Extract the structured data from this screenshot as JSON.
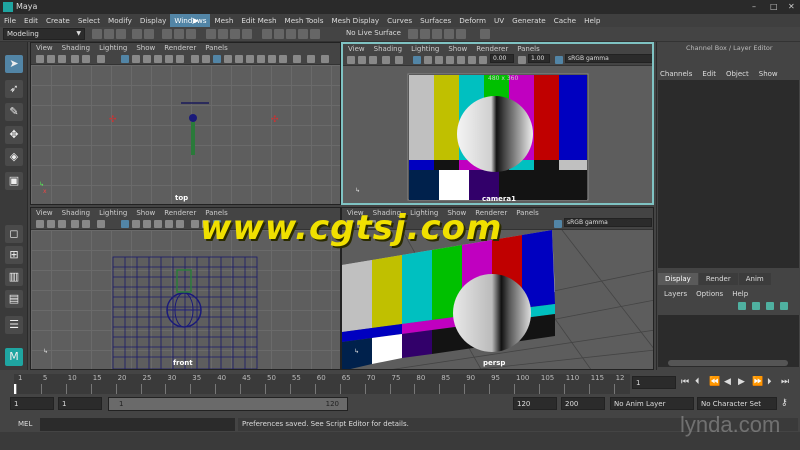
{
  "window": {
    "title": "Maya",
    "controls": [
      "–",
      "□",
      "✕"
    ]
  },
  "menubar": [
    "File",
    "Edit",
    "Create",
    "Select",
    "Modify",
    "Display",
    "Windows",
    "Mesh",
    "Edit Mesh",
    "Mesh Tools",
    "Mesh Display",
    "Curves",
    "Surfaces",
    "Deform",
    "UV",
    "Generate",
    "Cache",
    "Help"
  ],
  "menubar_selected": "Windows",
  "statusline": {
    "mode": "Modeling",
    "live_surface": "No Live Surface"
  },
  "viewport_menu": [
    "View",
    "Shading",
    "Lighting",
    "Show",
    "Renderer",
    "Panels"
  ],
  "viewports": {
    "top": {
      "label": "top"
    },
    "camera1": {
      "label": "camera1",
      "resolution": "480 x 360",
      "exposure": "0.00",
      "gamma": "1.00",
      "color_space": "sRGB gamma"
    },
    "front": {
      "label": "front"
    },
    "persp": {
      "label": "persp",
      "color_space": "sRGB gamma"
    }
  },
  "channel_box": {
    "title": "Channel Box / Layer Editor",
    "menu": [
      "Channels",
      "Edit",
      "Object",
      "Show"
    ]
  },
  "layer_editor": {
    "tabs": [
      "Display",
      "Render",
      "Anim"
    ],
    "menu": [
      "Layers",
      "Options",
      "Help"
    ]
  },
  "timeline": {
    "ticks": [
      "1",
      "5",
      "10",
      "15",
      "20",
      "25",
      "30",
      "35",
      "40",
      "45",
      "50",
      "55",
      "60",
      "65",
      "70",
      "75",
      "80",
      "85",
      "90",
      "95",
      "100",
      "105",
      "110",
      "115",
      "12"
    ],
    "current_frame": "1"
  },
  "range": {
    "start": "1",
    "playback_start": "1",
    "slider_start": "1",
    "slider_end": "120",
    "playback_end": "120",
    "end": "200",
    "anim_layer": "No Anim Layer",
    "character_set": "No Character Set"
  },
  "cmdline": {
    "label": "MEL",
    "response": "Preferences saved. See Script Editor for details."
  },
  "overlay": {
    "watermark": "www.cgtsj.com",
    "brand": "lynda.com"
  }
}
